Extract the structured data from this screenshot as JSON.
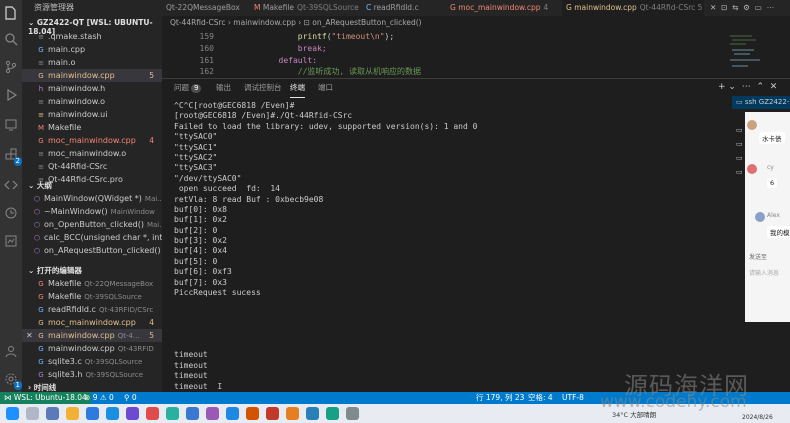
{
  "sidebar": {
    "title": "资源管理器",
    "root": "GZ2422-QT [WSL: UBUNTU-18.04]",
    "files": [
      {
        "name": ".qmake.stash",
        "icon": "≡",
        "color": "c-gray",
        "num": ""
      },
      {
        "name": "main.cpp",
        "icon": "G",
        "color": "c-blue",
        "num": ""
      },
      {
        "name": "main.o",
        "icon": "≡",
        "color": "c-gray",
        "num": ""
      },
      {
        "name": "mainwindow.cpp",
        "icon": "G",
        "color": "c-orange",
        "num": "5"
      },
      {
        "name": "mainwindow.h",
        "icon": "h",
        "color": "c-purple",
        "num": ""
      },
      {
        "name": "mainwindow.o",
        "icon": "≡",
        "color": "c-gray",
        "num": ""
      },
      {
        "name": "mainwindow.ui",
        "icon": "≡",
        "color": "c-orange",
        "num": ""
      },
      {
        "name": "Makefile",
        "icon": "M",
        "color": "c-red",
        "num": ""
      },
      {
        "name": "moc_mainwindow.cpp",
        "icon": "G",
        "color": "c-red",
        "num": "4"
      },
      {
        "name": "moc_mainwindow.o",
        "icon": "≡",
        "color": "c-gray",
        "num": ""
      },
      {
        "name": "Qt-44Rfid-CSrc",
        "icon": "≡",
        "color": "c-gray",
        "num": ""
      },
      {
        "name": "Qt-44Rfid-CSrc.pro",
        "icon": "≡",
        "color": "c-gray",
        "num": ""
      }
    ],
    "outline_title": "大纲",
    "outline": [
      {
        "name": "MainWindow(QWidget *)",
        "sub": "Mai..."
      },
      {
        "name": "~MainWindow()",
        "sub": "MainWindow"
      },
      {
        "name": "on_OpenButton_clicked()",
        "sub": "Mai..."
      },
      {
        "name": "calc_BCC(unsigned char *, int)",
        "sub": ""
      },
      {
        "name": "on_ARequestButton_clicked()",
        "sub": "..."
      }
    ],
    "open_title": "打开的编辑器",
    "open_editors": [
      {
        "name": "Makefile",
        "sub": "Qt-22QMessageBox",
        "color": "c-red",
        "num": ""
      },
      {
        "name": "Makefile",
        "sub": "Qt-39SQLSource",
        "color": "c-red",
        "num": ""
      },
      {
        "name": "readRfidld.c",
        "sub": "Qt-43RFID/CSrc",
        "color": "c-blue",
        "num": ""
      },
      {
        "name": "moc_mainwindow.cpp",
        "sub": "",
        "color": "c-orange",
        "num": "4"
      },
      {
        "name": "mainwindow.cpp",
        "sub": "Qt-4...",
        "color": "c-orange",
        "num": "5"
      },
      {
        "name": "mainwindow.cpp",
        "sub": "Qt-43RFID",
        "color": "c-blue",
        "num": ""
      },
      {
        "name": "sqlite3.c",
        "sub": "Qt-39SQLSource",
        "color": "c-blue",
        "num": ""
      },
      {
        "name": "sqlite3.h",
        "sub": "Qt-39SQLSource",
        "color": "c-purple",
        "num": ""
      }
    ],
    "timeline_title": "时间线"
  },
  "tabs": [
    {
      "label": "Qt-22QMessageBox",
      "sub": "",
      "active": false
    },
    {
      "label": "Makefile",
      "sub": "Qt-39SQLSource",
      "active": false
    },
    {
      "label": "readRfidld.c",
      "sub": "",
      "active": false
    },
    {
      "label": "moc_mainwindow.cpp",
      "sub": "4",
      "active": false
    },
    {
      "label": "mainwindow.cpp",
      "sub": "Qt-44Rfid-CSrc 5",
      "active": true
    }
  ],
  "breadcrumb": "Qt-44Rfid-CSrc  ›  mainwindow.cpp  ›  ⊡ on_ARequestButton_clicked()",
  "editor": {
    "lines": [
      {
        "n": "159",
        "pre": "            ",
        "fn": "printf",
        "str": "\"timeout\\n\"",
        "post": ");"
      },
      {
        "n": "160",
        "text": "            break;"
      },
      {
        "n": "161",
        "text": "        default:"
      },
      {
        "n": "162",
        "comment": "            //监听成功, 读取从机响应的数据"
      }
    ]
  },
  "panel": {
    "tabs": [
      "问题",
      "输出",
      "调试控制台",
      "终端",
      "端口"
    ],
    "problems_count": "9",
    "terminal_lines": [
      "^C^C[root@GEC6818 /Even]#",
      "[root@GEC6818 /Even]#./Qt-44Rfid-CSrc",
      "Failed to load the library: udev, supported version(s): 1 and 0",
      "\"ttySAC0\"",
      "\"ttySAC1\"",
      "\"ttySAC2\"",
      "\"ttySAC3\"",
      "\"/dev/ttySAC0\"",
      " open succeed  fd:  14",
      "retVla: 8 read Buf : 0xbecb9e08",
      "buf[0]: 0x8",
      "buf[1]: 0x2",
      "buf[2]: 0",
      "buf[3]: 0x2",
      "buf[4]: 0x4",
      "buf[5]: 0",
      "buf[6]: 0xf3",
      "buf[7]: 0x3",
      "PiccRequest sucess",
      "",
      "",
      "",
      "",
      "",
      "timeout",
      "timeout",
      "timeout",
      "timeout  I"
    ]
  },
  "termlist": [
    "ssh GZ2422-...",
    "ba",
    "ba",
    "ma",
    "ba"
  ],
  "chat": {
    "msg1": "水卡债",
    "user2": "cy",
    "msg2": "6",
    "user3": "Alex",
    "msg3": "我的模",
    "send": "发送至",
    "input_placeholder": "请输入消息"
  },
  "status": {
    "remote": "WSL: Ubuntu-18.04",
    "errors": "9",
    "warnings": "0",
    "radio": "0",
    "position": "行 179, 列 23",
    "spaces": "空格: 4",
    "encoding": "UTF-8"
  },
  "taskbar": {
    "weather": "34°C 大部晴朗",
    "date": "2024/8/26"
  },
  "watermark": {
    "line1": "源码海洋网",
    "line2": "www.codehy.com"
  }
}
